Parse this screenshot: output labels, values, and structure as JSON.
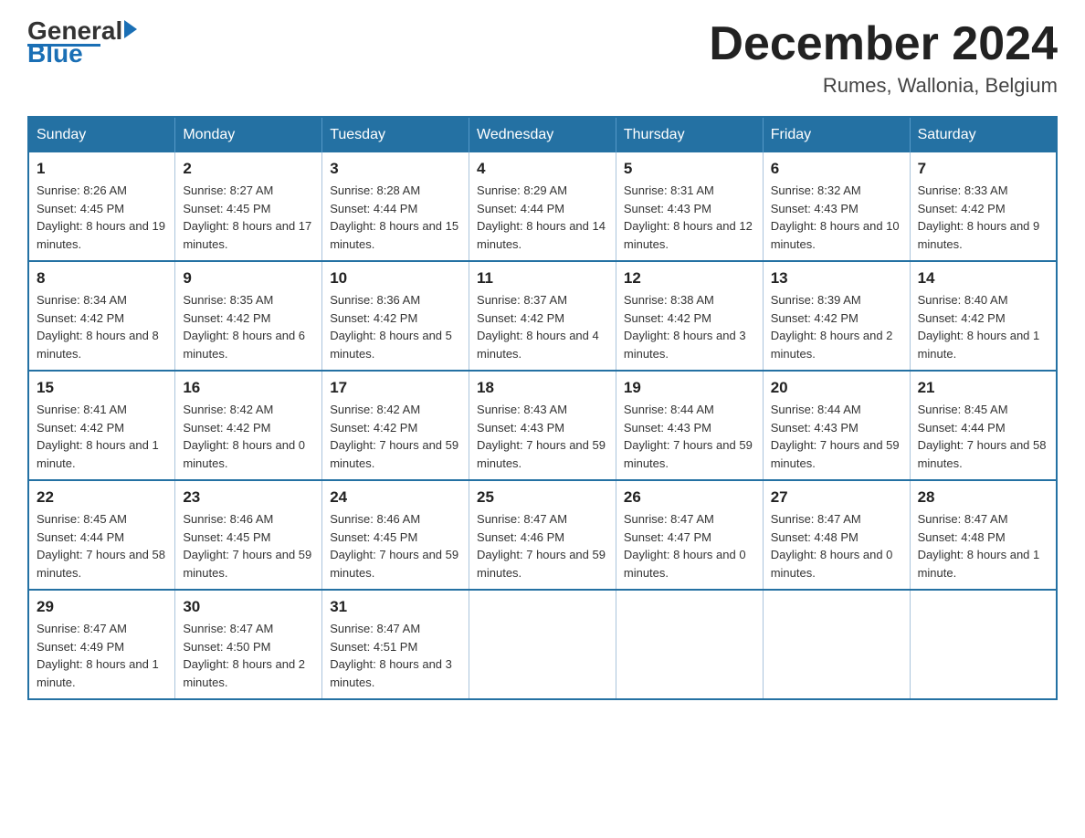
{
  "header": {
    "logo": {
      "general": "General",
      "blue": "Blue"
    },
    "title": "December 2024",
    "location": "Rumes, Wallonia, Belgium"
  },
  "calendar": {
    "days_of_week": [
      "Sunday",
      "Monday",
      "Tuesday",
      "Wednesday",
      "Thursday",
      "Friday",
      "Saturday"
    ],
    "weeks": [
      [
        {
          "day": "1",
          "sunrise": "8:26 AM",
          "sunset": "4:45 PM",
          "daylight": "8 hours and 19 minutes."
        },
        {
          "day": "2",
          "sunrise": "8:27 AM",
          "sunset": "4:45 PM",
          "daylight": "8 hours and 17 minutes."
        },
        {
          "day": "3",
          "sunrise": "8:28 AM",
          "sunset": "4:44 PM",
          "daylight": "8 hours and 15 minutes."
        },
        {
          "day": "4",
          "sunrise": "8:29 AM",
          "sunset": "4:44 PM",
          "daylight": "8 hours and 14 minutes."
        },
        {
          "day": "5",
          "sunrise": "8:31 AM",
          "sunset": "4:43 PM",
          "daylight": "8 hours and 12 minutes."
        },
        {
          "day": "6",
          "sunrise": "8:32 AM",
          "sunset": "4:43 PM",
          "daylight": "8 hours and 10 minutes."
        },
        {
          "day": "7",
          "sunrise": "8:33 AM",
          "sunset": "4:42 PM",
          "daylight": "8 hours and 9 minutes."
        }
      ],
      [
        {
          "day": "8",
          "sunrise": "8:34 AM",
          "sunset": "4:42 PM",
          "daylight": "8 hours and 8 minutes."
        },
        {
          "day": "9",
          "sunrise": "8:35 AM",
          "sunset": "4:42 PM",
          "daylight": "8 hours and 6 minutes."
        },
        {
          "day": "10",
          "sunrise": "8:36 AM",
          "sunset": "4:42 PM",
          "daylight": "8 hours and 5 minutes."
        },
        {
          "day": "11",
          "sunrise": "8:37 AM",
          "sunset": "4:42 PM",
          "daylight": "8 hours and 4 minutes."
        },
        {
          "day": "12",
          "sunrise": "8:38 AM",
          "sunset": "4:42 PM",
          "daylight": "8 hours and 3 minutes."
        },
        {
          "day": "13",
          "sunrise": "8:39 AM",
          "sunset": "4:42 PM",
          "daylight": "8 hours and 2 minutes."
        },
        {
          "day": "14",
          "sunrise": "8:40 AM",
          "sunset": "4:42 PM",
          "daylight": "8 hours and 1 minute."
        }
      ],
      [
        {
          "day": "15",
          "sunrise": "8:41 AM",
          "sunset": "4:42 PM",
          "daylight": "8 hours and 1 minute."
        },
        {
          "day": "16",
          "sunrise": "8:42 AM",
          "sunset": "4:42 PM",
          "daylight": "8 hours and 0 minutes."
        },
        {
          "day": "17",
          "sunrise": "8:42 AM",
          "sunset": "4:42 PM",
          "daylight": "7 hours and 59 minutes."
        },
        {
          "day": "18",
          "sunrise": "8:43 AM",
          "sunset": "4:43 PM",
          "daylight": "7 hours and 59 minutes."
        },
        {
          "day": "19",
          "sunrise": "8:44 AM",
          "sunset": "4:43 PM",
          "daylight": "7 hours and 59 minutes."
        },
        {
          "day": "20",
          "sunrise": "8:44 AM",
          "sunset": "4:43 PM",
          "daylight": "7 hours and 59 minutes."
        },
        {
          "day": "21",
          "sunrise": "8:45 AM",
          "sunset": "4:44 PM",
          "daylight": "7 hours and 58 minutes."
        }
      ],
      [
        {
          "day": "22",
          "sunrise": "8:45 AM",
          "sunset": "4:44 PM",
          "daylight": "7 hours and 58 minutes."
        },
        {
          "day": "23",
          "sunrise": "8:46 AM",
          "sunset": "4:45 PM",
          "daylight": "7 hours and 59 minutes."
        },
        {
          "day": "24",
          "sunrise": "8:46 AM",
          "sunset": "4:45 PM",
          "daylight": "7 hours and 59 minutes."
        },
        {
          "day": "25",
          "sunrise": "8:47 AM",
          "sunset": "4:46 PM",
          "daylight": "7 hours and 59 minutes."
        },
        {
          "day": "26",
          "sunrise": "8:47 AM",
          "sunset": "4:47 PM",
          "daylight": "8 hours and 0 minutes."
        },
        {
          "day": "27",
          "sunrise": "8:47 AM",
          "sunset": "4:48 PM",
          "daylight": "8 hours and 0 minutes."
        },
        {
          "day": "28",
          "sunrise": "8:47 AM",
          "sunset": "4:48 PM",
          "daylight": "8 hours and 1 minute."
        }
      ],
      [
        {
          "day": "29",
          "sunrise": "8:47 AM",
          "sunset": "4:49 PM",
          "daylight": "8 hours and 1 minute."
        },
        {
          "day": "30",
          "sunrise": "8:47 AM",
          "sunset": "4:50 PM",
          "daylight": "8 hours and 2 minutes."
        },
        {
          "day": "31",
          "sunrise": "8:47 AM",
          "sunset": "4:51 PM",
          "daylight": "8 hours and 3 minutes."
        },
        null,
        null,
        null,
        null
      ]
    ]
  }
}
